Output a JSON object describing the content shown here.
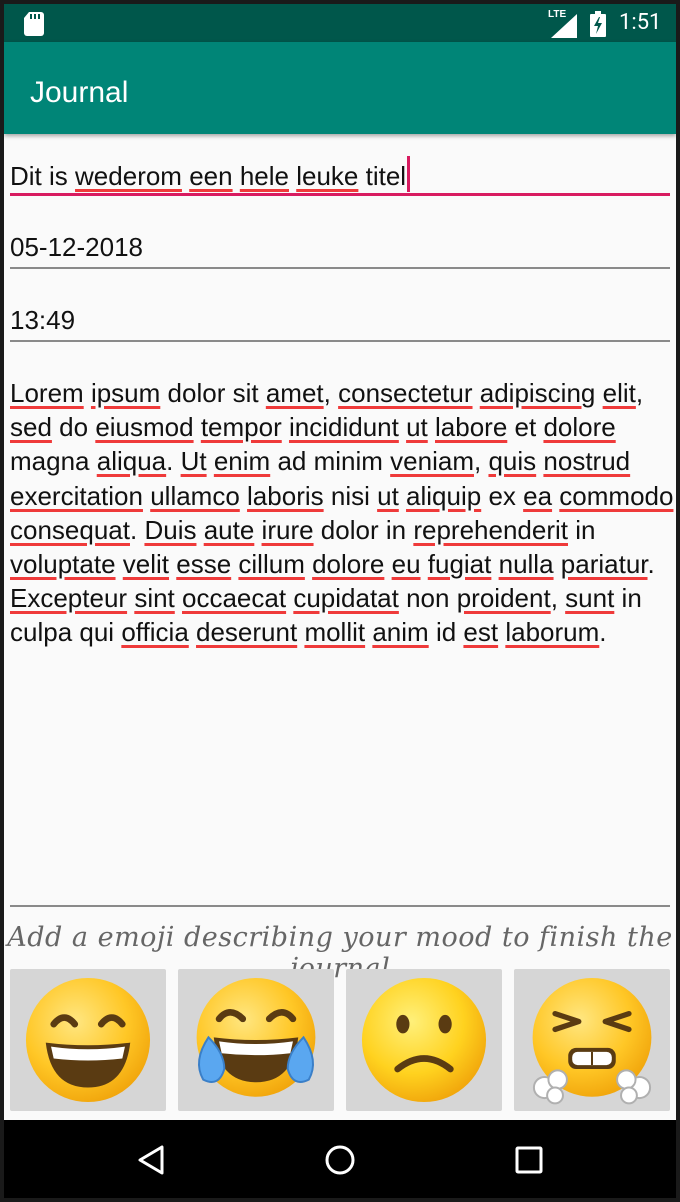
{
  "status_bar": {
    "time": "1:51",
    "network": "LTE",
    "icons": [
      "sd-card-icon",
      "signal-icon",
      "battery-charging-icon"
    ]
  },
  "app_bar": {
    "title": "Journal"
  },
  "form": {
    "title_value": "Dit is wederom een hele leuke titel",
    "date_value": "05-12-2018",
    "time_value": "13:49",
    "body_value": "Lorem ipsum dolor sit amet, consectetur adipiscing elit, sed do eiusmod tempor incididunt ut labore et dolore magna aliqua. Ut enim ad minim veniam, quis nostrud exercitation ullamco laboris nisi ut aliquip ex ea commodo consequat. Duis aute irure dolor in reprehenderit in voluptate velit esse cillum dolore eu fugiat nulla pariatur. Excepteur sint occaecat cupidatat non proident, sunt in culpa qui officia deserunt mollit anim id est laborum."
  },
  "mood": {
    "prompt": "Add a emoji describing your mood to finish the journal",
    "options": [
      "grinning-emoji",
      "tears-of-joy-emoji",
      "frowning-emoji",
      "angry-steam-emoji"
    ]
  },
  "nav": {
    "icons": [
      "back-icon",
      "home-icon",
      "recents-icon"
    ]
  },
  "colors": {
    "status_bar": "#00574b",
    "app_bar": "#008577",
    "accent": "#d81b60",
    "spell_underline": "#ef3a3a"
  }
}
